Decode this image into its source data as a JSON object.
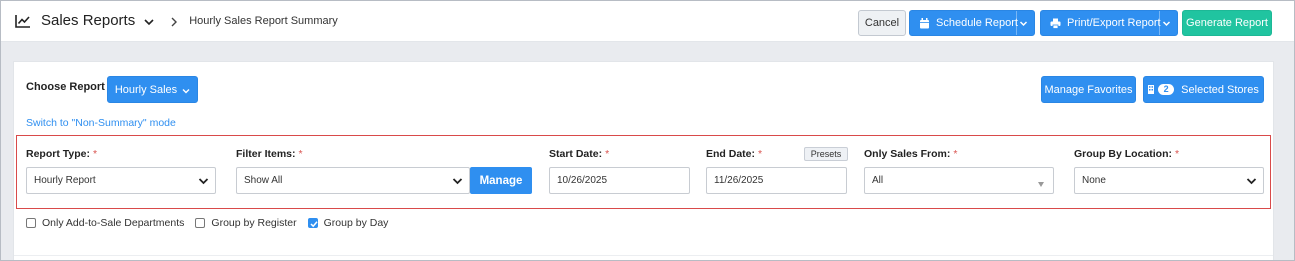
{
  "header": {
    "title": "Sales Reports",
    "breadcrumb": "Hourly Sales Report Summary",
    "buttons": {
      "cancel": "Cancel",
      "schedule": "Schedule Report",
      "print": "Print/Export Report",
      "generate": "Generate Report"
    }
  },
  "report": {
    "choose_label": "Choose Report",
    "selected_report": "Hourly Sales",
    "switch_mode": "Switch to \"Non-Summary\" mode",
    "manage_favorites": "Manage Favorites",
    "selected_stores_count": "2",
    "selected_stores_label": "Selected Stores"
  },
  "filters": {
    "report_type": {
      "label": "Report Type:",
      "value": "Hourly Report"
    },
    "filter_items": {
      "label": "Filter Items:",
      "value": "Show All",
      "manage": "Manage"
    },
    "start_date": {
      "label": "Start Date:",
      "value": "10/26/2025"
    },
    "end_date": {
      "label": "End Date:",
      "value": "11/26/2025",
      "presets": "Presets"
    },
    "only_sales_from": {
      "label": "Only Sales From:",
      "value": "All"
    },
    "group_by_location": {
      "label": "Group By Location:",
      "value": "None"
    },
    "required_mark": "*"
  },
  "options": [
    {
      "label": "Only Add-to-Sale Departments",
      "checked": false
    },
    {
      "label": "Group by Register",
      "checked": false
    },
    {
      "label": "Group by Day",
      "checked": true
    }
  ],
  "colors": {
    "accent": "#2f8ff0",
    "success": "#20c4a0",
    "required": "#d9534f"
  }
}
